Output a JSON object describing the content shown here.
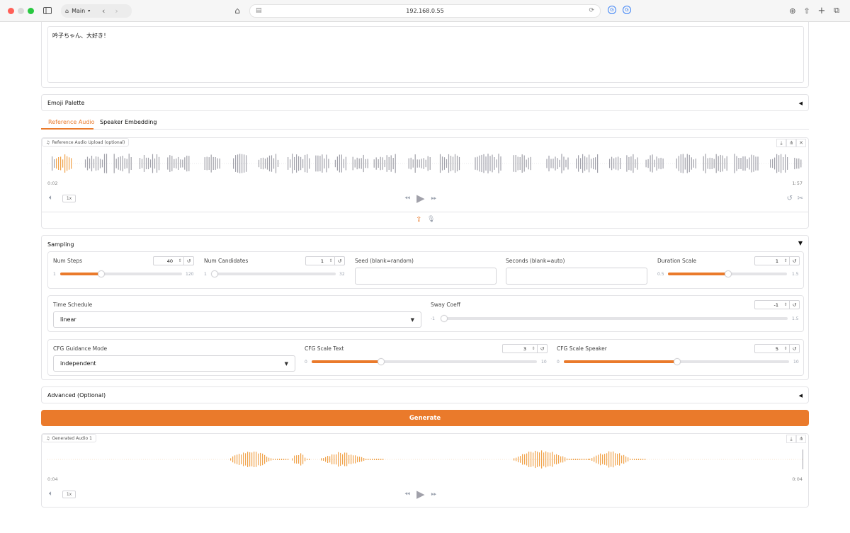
{
  "browser": {
    "profile_label": "Main",
    "url": "192.168.0.55"
  },
  "text_input": {
    "value": "吟子ちゃん、大好き！"
  },
  "emoji_palette": {
    "title": "Emoji Palette",
    "arrow": "◀"
  },
  "tabs": [
    {
      "label": "Reference Audio",
      "active": true
    },
    {
      "label": "Speaker Embedding",
      "active": false
    }
  ],
  "reference_audio": {
    "label": "Reference Audio Upload (optional)",
    "current_time": "0:02",
    "duration": "1:57",
    "speed": "1x",
    "progress": 0.027
  },
  "sampling": {
    "title": "Sampling",
    "arrow": "▼",
    "num_steps": {
      "label": "Num Steps",
      "value": "40",
      "min": "1",
      "max": "120"
    },
    "num_candidates": {
      "label": "Num Candidates",
      "value": "1",
      "min": "1",
      "max": "32"
    },
    "seed": {
      "label": "Seed (blank=random)",
      "value": ""
    },
    "seconds": {
      "label": "Seconds (blank=auto)",
      "value": ""
    },
    "duration_scale": {
      "label": "Duration Scale",
      "value": "1",
      "min": "0.5",
      "max": "1.5"
    },
    "time_schedule": {
      "label": "Time Schedule",
      "value": "linear"
    },
    "sway_coeff": {
      "label": "Sway Coeff",
      "value": "-1",
      "min": "-1",
      "max": "1.5"
    },
    "cfg_guidance_mode": {
      "label": "CFG Guidance Mode",
      "value": "independent"
    },
    "cfg_scale_text": {
      "label": "CFG Scale Text",
      "value": "3",
      "min": "0",
      "max": "10"
    },
    "cfg_scale_speaker": {
      "label": "CFG Scale Speaker",
      "value": "5",
      "min": "0",
      "max": "10"
    }
  },
  "advanced": {
    "title": "Advanced (Optional)",
    "arrow": "◀"
  },
  "generate": {
    "label": "Generate"
  },
  "generated_audio": {
    "label": "Generated Audio 1",
    "current_time": "0:04",
    "duration": "0:04",
    "speed": "1x"
  },
  "colors": {
    "accent": "#ea7a2b",
    "wave_gray": "#a1a1aa",
    "wave_orange": "#f0a24a"
  }
}
